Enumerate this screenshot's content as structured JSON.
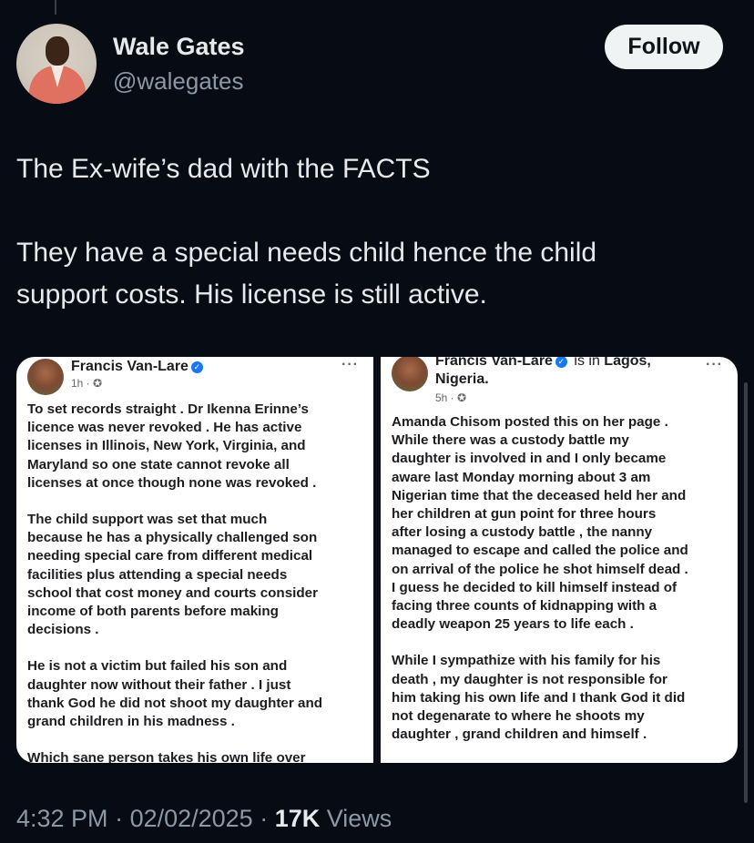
{
  "author": {
    "name": "Wale Gates",
    "handle": "@walegates",
    "follow_label": "Follow"
  },
  "tweet": {
    "line1": "The Ex-wife’s dad with the FACTS",
    "line2": "They have a special needs child hence the child",
    "line3": "support costs. His license is still active."
  },
  "media": {
    "left": {
      "author": "Francis Van-Lare",
      "time": "1h · ",
      "more": "···",
      "lines": [
        "To set records straight . Dr Ikenna Erinne’s",
        "licence was never revoked . He has active",
        "licenses in Illinois, New York, Virginia, and",
        "Maryland so one state cannot revoke all",
        "licenses at once though none was revoked .",
        "The child support was set that much",
        "because he has a physically challenged son",
        "needing special care from different medical",
        "facilities plus attending a special  needs",
        "school that cost money and courts consider",
        "income of both parents before making",
        "decisions .",
        "He is not a victim but failed his son  and",
        "daughter now without their father  . I just",
        "thank God he did not shoot my daughter and",
        "grand children  in his madness .",
        "Which sane person takes his own life  over"
      ]
    },
    "right": {
      "author": "Francis Van-Lare",
      "location_prefix": " is in ",
      "location": "Lagos,",
      "location2": "Nigeria.",
      "time": "5h · ",
      "more": "···",
      "lines": [
        "Amanda Chisom posted this on her page .",
        "While there was a custody battle my",
        "daughter is involved in and I only became",
        "aware last Monday morning about 3 am",
        "Nigerian time that the deceased held her and",
        "her children at gun point for three hours",
        "after losing a custody battle , the nanny",
        "managed to escape and called the police and",
        "on arrival of the police he shot himself dead .",
        "I guess he decided to kill himself instead of",
        "facing three counts of kidnapping with a",
        "deadly weapon 25 years to life each .",
        "While I sympathize with his family for his",
        "death , my daughter is not responsible for",
        "him taking his own life and I thank God it did",
        "not degenarate to where he shoots my",
        "daughter , grand children and himself ."
      ]
    }
  },
  "meta": {
    "time": "4:32 PM",
    "sep1": " · ",
    "date": "02/02/2025",
    "sep2": " · ",
    "views_count": "17K",
    "views_label": " Views"
  }
}
